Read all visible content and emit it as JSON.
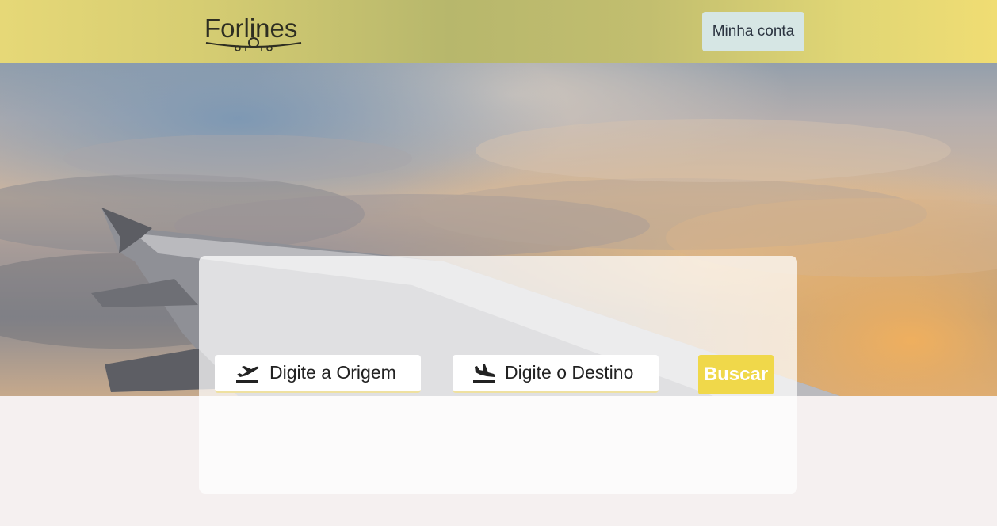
{
  "header": {
    "brand": "Forlines",
    "account_label": "Minha conta"
  },
  "search": {
    "origin_placeholder": "Digite a Origem",
    "destination_placeholder": "Digite o Destino",
    "submit_label": "Buscar",
    "origin_icon": "airplane-takeoff-icon",
    "destination_icon": "airplane-landing-icon"
  },
  "colors": {
    "header_accent": "#d6cd72",
    "account_button": "#d6e6e4",
    "search_button": "#f0d84a",
    "page_background": "#f5f0f0"
  }
}
